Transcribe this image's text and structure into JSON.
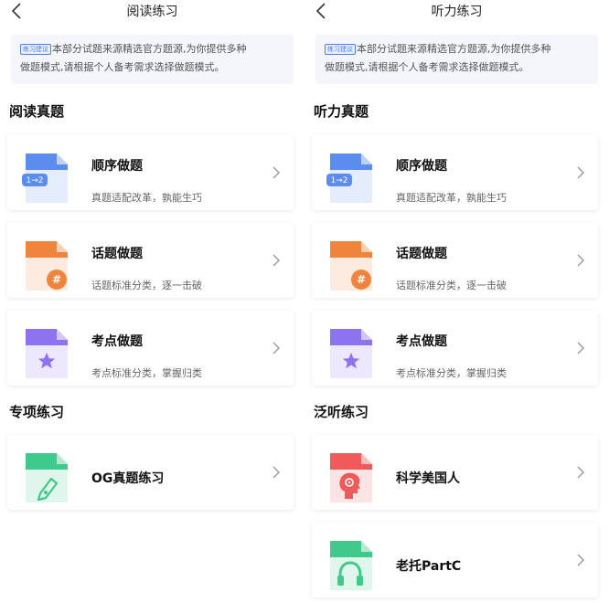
{
  "tip": {
    "badge": "练习建议",
    "line1": "本部分试题来源精选官方题源,为你提供多种",
    "line2": "做题模式,请根据个人备考需求选择做题模式。"
  },
  "reading": {
    "title": "阅读练习",
    "section_real": "阅读真题",
    "section_special": "专项练习",
    "cards": [
      {
        "title": "顺序做题",
        "subtitle": "真题适配改革，孰能生巧",
        "icon": "order-doc-icon",
        "icon_text": "1→2",
        "color": "#5b8def"
      },
      {
        "title": "话题做题",
        "subtitle": "话题标准分类，逐一击破",
        "icon": "topic-hash-doc-icon",
        "icon_text": "#",
        "color": "#f0843c"
      },
      {
        "title": "考点做题",
        "subtitle": "考点标准分类，掌握归类",
        "icon": "star-doc-icon",
        "color": "#8d73f0"
      }
    ],
    "special_card": {
      "title": "OG真题练习",
      "icon": "pen-doc-icon",
      "color": "#3fc98b"
    }
  },
  "listening": {
    "title": "听力练习",
    "section_real": "听力真题",
    "section_extensive": "泛听练习",
    "cards": [
      {
        "title": "顺序做题",
        "subtitle": "真题适配改革，孰能生巧",
        "icon": "order-doc-icon",
        "icon_text": "1→2",
        "color": "#5b8def"
      },
      {
        "title": "话题做题",
        "subtitle": "话题标准分类，逐一击破",
        "icon": "topic-hash-doc-icon",
        "icon_text": "#",
        "color": "#f0843c"
      },
      {
        "title": "考点做题",
        "subtitle": "考点标准分类，掌握归类",
        "icon": "star-doc-icon",
        "color": "#8d73f0"
      }
    ],
    "extensive_cards": [
      {
        "title": "科学美国人",
        "icon": "head-listening-doc-icon",
        "color": "#f05a5a"
      },
      {
        "title": "老托PartC",
        "icon": "headphones-doc-icon",
        "color": "#3fc98b"
      }
    ]
  }
}
